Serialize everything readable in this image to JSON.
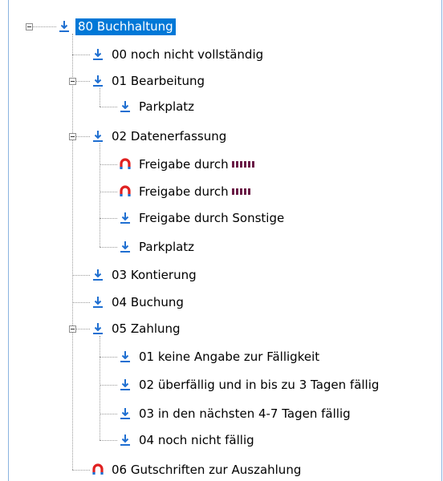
{
  "tree": {
    "root": {
      "label": "80 Buchhaltung",
      "icon": "download-icon",
      "selected": true
    },
    "items": [
      {
        "label": "00 noch nicht vollständig",
        "icon": "download-icon"
      },
      {
        "label": "01 Bearbeitung",
        "icon": "download-icon"
      },
      {
        "label": "Parkplatz",
        "icon": "download-icon"
      },
      {
        "label": "02 Datenerfassung",
        "icon": "download-icon"
      },
      {
        "label": "Freigabe durch",
        "icon": "magnet-icon",
        "redacted": true
      },
      {
        "label": "Freigabe durch",
        "icon": "magnet-icon",
        "redacted": true
      },
      {
        "label": "Freigabe durch Sonstige",
        "icon": "download-icon"
      },
      {
        "label": "Parkplatz",
        "icon": "download-icon"
      },
      {
        "label": "03 Kontierung",
        "icon": "download-icon"
      },
      {
        "label": "04 Buchung",
        "icon": "download-icon"
      },
      {
        "label": "05 Zahlung",
        "icon": "download-icon"
      },
      {
        "label": "01 keine Angabe zur Fälligkeit",
        "icon": "download-icon"
      },
      {
        "label": "02 überfällig und in bis zu 3 Tagen fällig",
        "icon": "download-icon"
      },
      {
        "label": "03 in den nächsten 4-7 Tagen fällig",
        "icon": "download-icon"
      },
      {
        "label": "04 noch nicht fällig",
        "icon": "download-icon"
      },
      {
        "label": "06 Gutschriften zur Auszahlung",
        "icon": "magnet-icon"
      }
    ]
  },
  "colors": {
    "selection": "#0078d7",
    "download_icon": "#1f6fd1",
    "magnet_icon": "#e02020",
    "frame_line": "#8ab4e0"
  }
}
